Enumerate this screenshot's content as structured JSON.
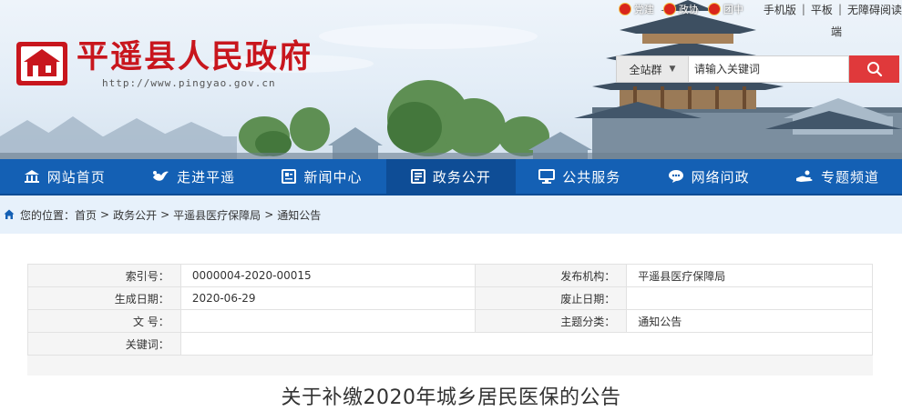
{
  "header": {
    "site_title": "平遥县人民政府",
    "site_url": "http://www.pingyao.gov.cn",
    "party_links": [
      "党建",
      "政协",
      "团中"
    ],
    "top_links": [
      "手机版",
      "平板",
      "无障碍阅读"
    ],
    "top_links_wrap": "端",
    "search": {
      "scope": "全站群",
      "placeholder": "请输入关键词"
    }
  },
  "nav": {
    "items": [
      {
        "label": "网站首页",
        "icon": "home-icon"
      },
      {
        "label": "走进平遥",
        "icon": "bird-icon"
      },
      {
        "label": "新闻中心",
        "icon": "news-icon"
      },
      {
        "label": "政务公开",
        "icon": "document-icon"
      },
      {
        "label": "公共服务",
        "icon": "monitor-icon"
      },
      {
        "label": "网络问政",
        "icon": "chat-icon"
      },
      {
        "label": "专题频道",
        "icon": "hand-icon"
      }
    ]
  },
  "breadcrumb": {
    "prefix": "您的位置：",
    "items": [
      "首页",
      "政务公开",
      "平遥县医疗保障局",
      "通知公告"
    ]
  },
  "meta": {
    "rows": [
      {
        "k1": "索引号：",
        "v1": "0000004-2020-00015",
        "k2": "发布机构：",
        "v2": "平遥县医疗保障局"
      },
      {
        "k1": "生成日期：",
        "v1": "2020-06-29",
        "k2": "废止日期：",
        "v2": ""
      },
      {
        "k1": "文 号：",
        "v1": "",
        "k2": "主题分类：",
        "v2": "通知公告"
      },
      {
        "k1": "关键词：",
        "v1": ""
      }
    ]
  },
  "document": {
    "title": "关于补缴2020年城乡居民医保的公告"
  },
  "colors": {
    "nav_bg": "#1460b4",
    "nav_active": "#0e4d96",
    "title_red": "#c8161d",
    "search_btn": "#e0393b",
    "crumb_bg": "#e7f1fb"
  }
}
